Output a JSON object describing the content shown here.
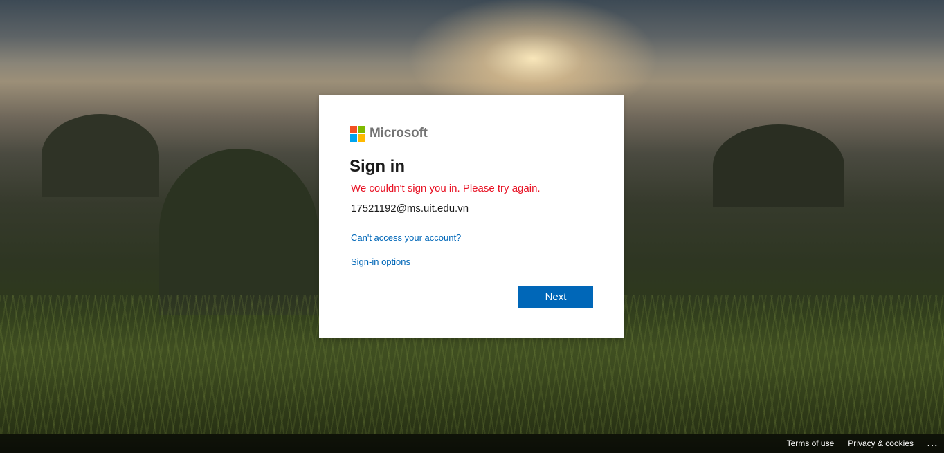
{
  "brand": {
    "name": "Microsoft",
    "logo_colors": [
      "#f25022",
      "#7fba00",
      "#00a4ef",
      "#ffb900"
    ]
  },
  "signin": {
    "title": "Sign in",
    "error": "We couldn't sign you in. Please try again.",
    "email_value": "17521192@ms.uit.edu.vn",
    "cant_access_link": "Can't access your account?",
    "options_link": "Sign-in options",
    "next_label": "Next"
  },
  "footer": {
    "terms": "Terms of use",
    "privacy": "Privacy & cookies",
    "more": "..."
  },
  "colors": {
    "accent": "#0067b8",
    "error": "#e81123"
  }
}
